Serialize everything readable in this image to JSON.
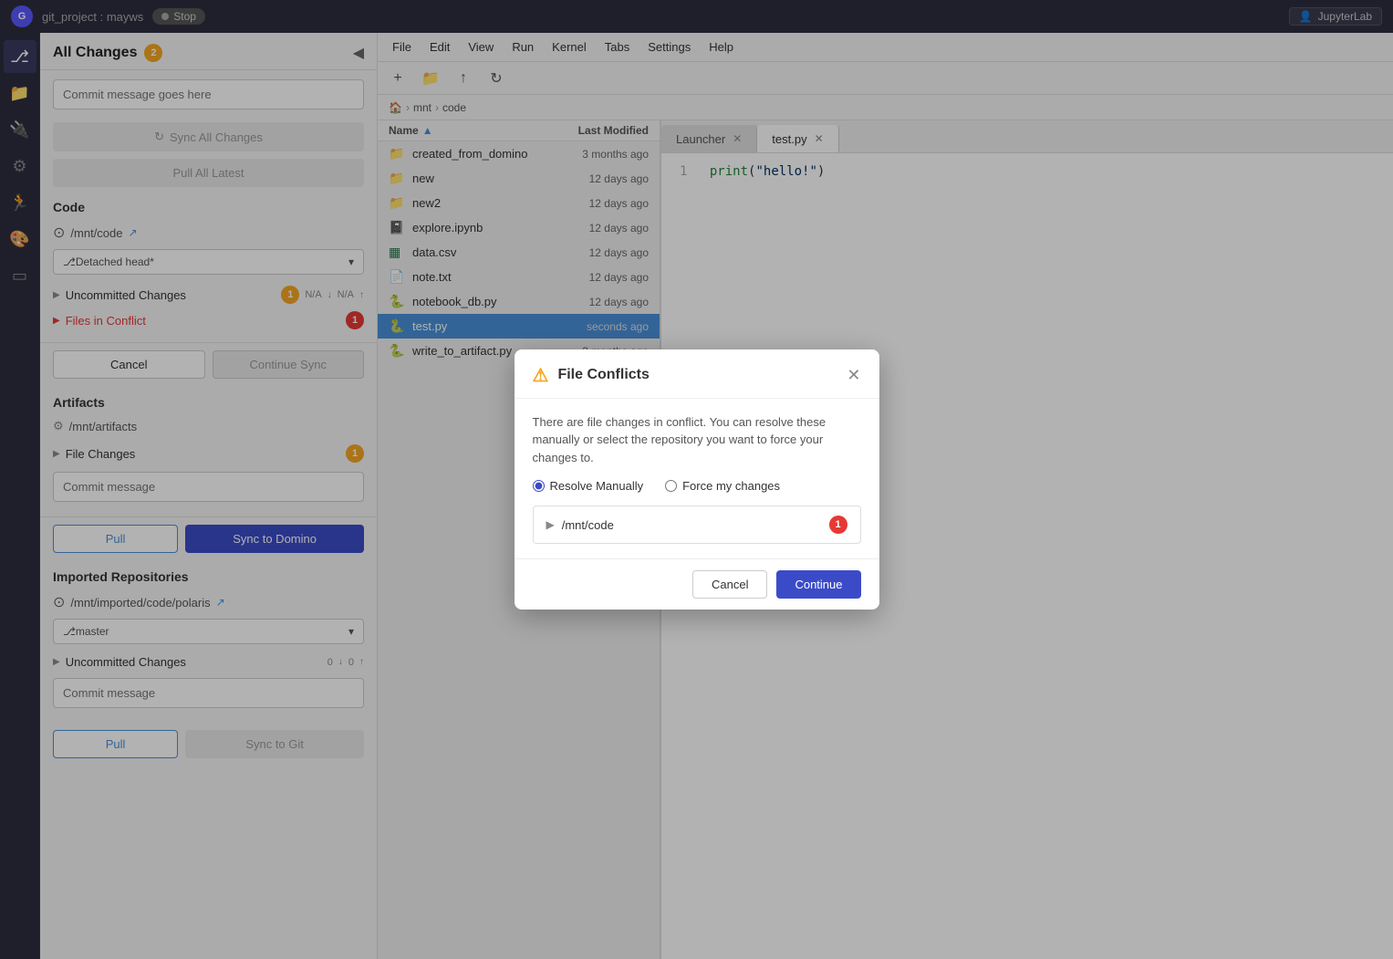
{
  "topbar": {
    "logo": "G",
    "project": "git_project : mayws",
    "stop_label": "Stop",
    "jupyterlab_label": "JupyterLab"
  },
  "git_panel": {
    "title": "All Changes",
    "badge_count": "2",
    "commit_placeholder": "Commit message goes here",
    "sync_all_label": "Sync All Changes",
    "pull_all_label": "Pull All Latest",
    "code_section": {
      "title": "Code",
      "repo_path": "/mnt/code",
      "branch": "Detached head*",
      "uncommitted_label": "Uncommitted Changes",
      "uncommitted_count": "1",
      "uncommitted_down": "N/A",
      "uncommitted_up": "N/A",
      "conflict_label": "Files in Conflict",
      "conflict_count": "1",
      "cancel_label": "Cancel",
      "continue_sync_label": "Continue Sync"
    },
    "artifacts_section": {
      "title": "Artifacts",
      "repo_path": "/mnt/artifacts",
      "file_changes_label": "File Changes",
      "file_changes_count": "1",
      "commit_placeholder": "Commit message",
      "pull_label": "Pull",
      "sync_label": "Sync to Domino"
    },
    "imported_section": {
      "title": "Imported Repositories",
      "repo_path": "/mnt/imported/code/polaris",
      "branch": "master",
      "uncommitted_label": "Uncommitted Changes",
      "uncommitted_down": "0",
      "uncommitted_up": "0",
      "commit_placeholder": "Commit message",
      "pull_label": "Pull",
      "sync_label": "Sync to Git"
    }
  },
  "jupyterlab": {
    "menu_items": [
      "File",
      "Edit",
      "View",
      "Run",
      "Kernel",
      "Tabs",
      "Settings",
      "Help"
    ],
    "breadcrumb": [
      "mnt",
      "code"
    ],
    "file_browser": {
      "cols": {
        "name": "Name",
        "modified": "Last Modified"
      },
      "files": [
        {
          "name": "created_from_domino",
          "type": "folder",
          "modified": "3 months ago"
        },
        {
          "name": "new",
          "type": "folder",
          "modified": "12 days ago"
        },
        {
          "name": "new2",
          "type": "folder",
          "modified": "12 days ago"
        },
        {
          "name": "explore.ipynb",
          "type": "notebook",
          "modified": "12 days ago"
        },
        {
          "name": "data.csv",
          "type": "csv",
          "modified": "12 days ago"
        },
        {
          "name": "note.txt",
          "type": "text",
          "modified": "12 days ago"
        },
        {
          "name": "notebook_db.py",
          "type": "python",
          "modified": "12 days ago"
        },
        {
          "name": "test.py",
          "type": "python",
          "modified": "seconds ago",
          "selected": true
        },
        {
          "name": "write_to_artifact.py",
          "type": "python",
          "modified": "3 months ago"
        }
      ]
    },
    "tabs": [
      {
        "label": "Launcher",
        "active": false,
        "closeable": true
      },
      {
        "label": "test.py",
        "active": true,
        "closeable": true
      }
    ],
    "editor_code": "print(\"hello!\")"
  },
  "dialog": {
    "title": "File Conflicts",
    "body_text": "There are file changes in conflict. You can resolve these manually or select the repository you want to force your changes to.",
    "resolve_manually_label": "Resolve Manually",
    "force_changes_label": "Force my changes",
    "repo_name": "/mnt/code",
    "conflict_count": "1",
    "cancel_label": "Cancel",
    "continue_label": "Continue"
  }
}
